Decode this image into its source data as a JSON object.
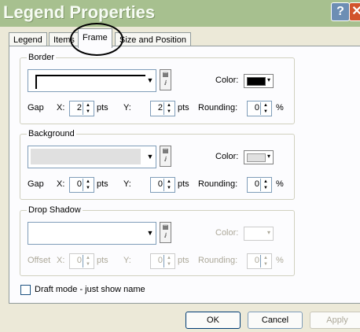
{
  "window": {
    "title": "Legend Properties",
    "help_label": "?",
    "close_label": "✕"
  },
  "tabs": [
    {
      "label": "Legend"
    },
    {
      "label": "Items"
    },
    {
      "label": "Frame",
      "active": true
    },
    {
      "label": "Size and Position"
    }
  ],
  "border": {
    "title": "Border",
    "color_label": "Color:",
    "color_value": "#000000",
    "gap_label": "Gap",
    "x_label": "X:",
    "x_value": "2",
    "x_unit": "pts",
    "y_label": "Y:",
    "y_value": "2",
    "y_unit": "pts",
    "rounding_label": "Rounding:",
    "rounding_value": "0",
    "rounding_unit": "%"
  },
  "background": {
    "title": "Background",
    "color_label": "Color:",
    "color_value": "#e0e0e0",
    "gap_label": "Gap",
    "x_label": "X:",
    "x_value": "0",
    "x_unit": "pts",
    "y_label": "Y:",
    "y_value": "0",
    "y_unit": "pts",
    "rounding_label": "Rounding:",
    "rounding_value": "0",
    "rounding_unit": "%"
  },
  "drop_shadow": {
    "title": "Drop Shadow",
    "color_label": "Color:",
    "offset_label": "Offset",
    "x_label": "X:",
    "x_value": "0",
    "x_unit": "pts",
    "y_label": "Y:",
    "y_value": "0",
    "y_unit": "pts",
    "rounding_label": "Rounding:",
    "rounding_value": "0",
    "rounding_unit": "%"
  },
  "draft_mode": {
    "label": "Draft mode - just show name",
    "checked": false
  },
  "buttons": {
    "ok": "OK",
    "cancel": "Cancel",
    "apply": "Apply"
  }
}
